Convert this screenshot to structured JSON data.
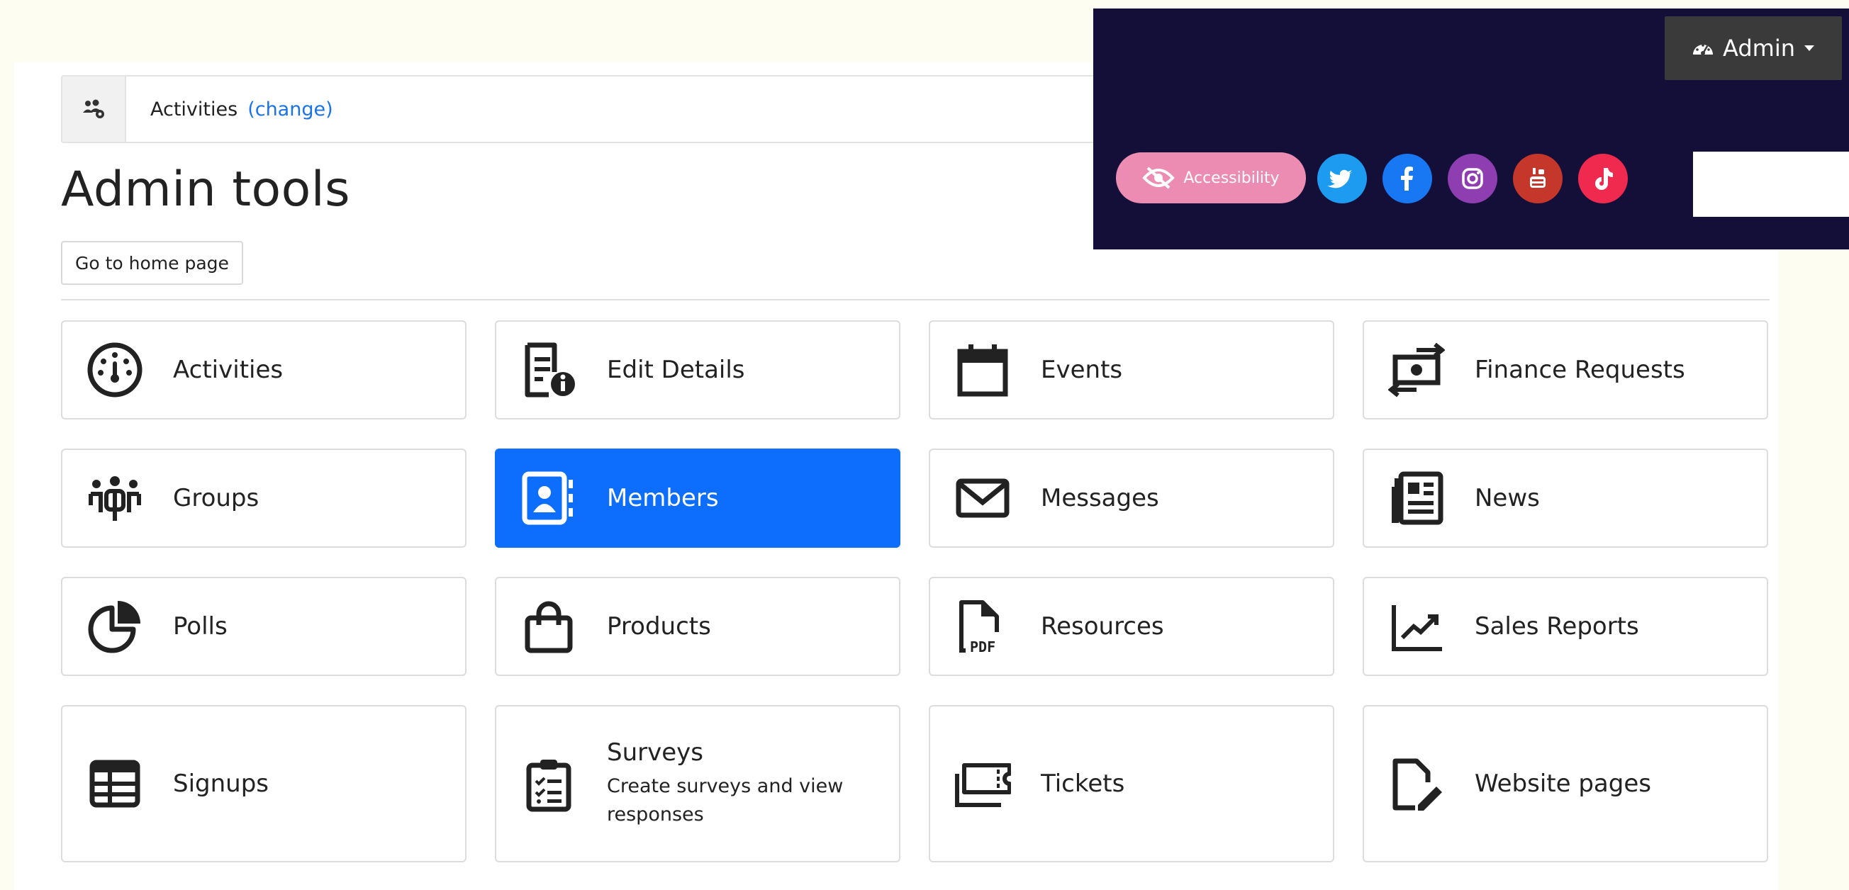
{
  "breadcrumb": {
    "context": "Activities",
    "change_label": "(change)"
  },
  "page": {
    "title": "Admin tools",
    "home_button": "Go to home page"
  },
  "tiles": [
    {
      "label": "Activities",
      "icon": "gauge-icon"
    },
    {
      "label": "Edit Details",
      "icon": "file-info-icon"
    },
    {
      "label": "Events",
      "icon": "calendar-icon"
    },
    {
      "label": "Finance Requests",
      "icon": "money-exchange-icon"
    },
    {
      "label": "Groups",
      "icon": "people-group-icon"
    },
    {
      "label": "Members",
      "icon": "address-book-icon",
      "active": true
    },
    {
      "label": "Messages",
      "icon": "envelope-icon"
    },
    {
      "label": "News",
      "icon": "newspaper-icon"
    },
    {
      "label": "Polls",
      "icon": "pie-chart-icon"
    },
    {
      "label": "Products",
      "icon": "shopping-bag-icon"
    },
    {
      "label": "Resources",
      "icon": "pdf-file-icon"
    },
    {
      "label": "Sales Reports",
      "icon": "line-chart-icon"
    },
    {
      "label": "Signups",
      "icon": "table-icon"
    },
    {
      "label": "Surveys",
      "description": "Create surveys and view responses",
      "icon": "clipboard-list-icon"
    },
    {
      "label": "Tickets",
      "icon": "ticket-icon"
    },
    {
      "label": "Website pages",
      "icon": "file-pen-icon"
    }
  ],
  "header": {
    "admin_label": "Admin",
    "accessibility_label": "Accessibility",
    "socials": [
      "twitter",
      "facebook",
      "instagram",
      "youtube",
      "tiktok"
    ]
  },
  "colors": {
    "accent": "#0d6efd",
    "header_bg": "#140f39",
    "accessibility": "#ec8cb2",
    "twitter": "#1d9bf0",
    "facebook": "#1877f2",
    "instagram": "#8e3eb0",
    "youtube": "#c4372a",
    "tiktok": "#f0294e"
  }
}
